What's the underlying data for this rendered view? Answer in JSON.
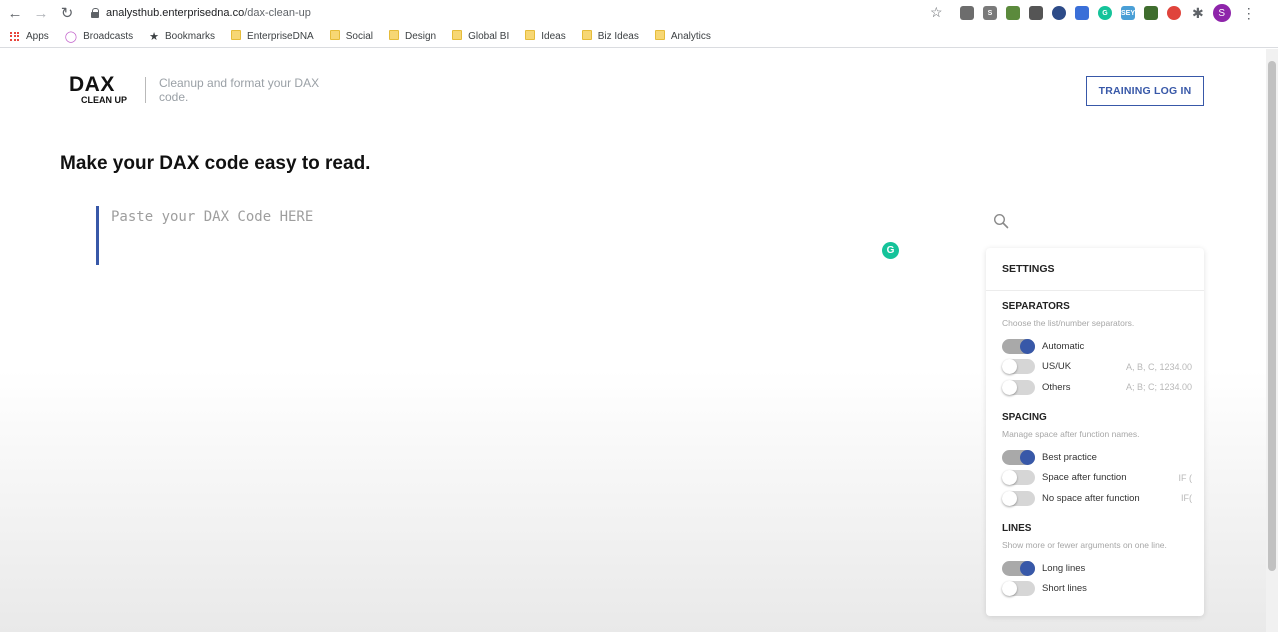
{
  "browser": {
    "url_host": "analysthub.enterprisedna.co",
    "url_path": "/dax-clean-up",
    "profile_initial": "S",
    "extensions": [
      {
        "name": "screenshot-ext-icon",
        "color": "#6d6d6d",
        "glyph": ""
      },
      {
        "name": "skype-ext-icon",
        "color": "#7a7a7a",
        "glyph": "S"
      },
      {
        "name": "evernote-ext-icon",
        "color": "#5b8a3c",
        "glyph": ""
      },
      {
        "name": "keep-ext-icon",
        "color": "#555555",
        "glyph": ""
      },
      {
        "name": "circle-ext-icon",
        "color": "#2d4b88",
        "glyph": ""
      },
      {
        "name": "reader-ext-icon",
        "color": "#3a6fd8",
        "glyph": ""
      },
      {
        "name": "grammarly-ext-icon",
        "color": "#15c39a",
        "glyph": "G"
      },
      {
        "name": "sey-ext-icon",
        "color": "#4a9fd6",
        "glyph": "SEY"
      },
      {
        "name": "leaf-ext-icon",
        "color": "#3f6d2e",
        "glyph": ""
      },
      {
        "name": "target-ext-icon",
        "color": "#e0443c",
        "glyph": ""
      }
    ],
    "bookmarks": [
      {
        "label": "Apps",
        "icon": "apps-grid-icon"
      },
      {
        "label": "Broadcasts",
        "icon": "broadcast-icon"
      },
      {
        "label": "Bookmarks",
        "icon": "star-icon"
      },
      {
        "label": "EnterpriseDNA",
        "icon": "folder-icon"
      },
      {
        "label": "Social",
        "icon": "folder-icon"
      },
      {
        "label": "Design",
        "icon": "folder-icon"
      },
      {
        "label": "Global BI",
        "icon": "folder-icon"
      },
      {
        "label": "Ideas",
        "icon": "folder-icon"
      },
      {
        "label": "Biz Ideas",
        "icon": "folder-icon"
      },
      {
        "label": "Analytics",
        "icon": "folder-icon"
      }
    ]
  },
  "header": {
    "logo_main": "DAX",
    "logo_sub": "CLEAN UP",
    "tagline": "Cleanup and format your DAX code.",
    "training_button": "TRAINING LOG IN"
  },
  "main": {
    "headline": "Make your DAX code easy to read.",
    "editor_placeholder": "Paste your DAX Code HERE"
  },
  "settings": {
    "title": "SETTINGS",
    "sections": [
      {
        "title": "SEPARATORS",
        "description": "Choose the list/number separators.",
        "options": [
          {
            "label": "Automatic",
            "hint": "",
            "on": true
          },
          {
            "label": "US/UK",
            "hint": "A, B, C, 1234.00",
            "on": false
          },
          {
            "label": "Others",
            "hint": "A; B; C; 1234.00",
            "on": false
          }
        ]
      },
      {
        "title": "SPACING",
        "description": "Manage space after function names.",
        "options": [
          {
            "label": "Best practice",
            "hint": "",
            "on": true
          },
          {
            "label": "Space after function",
            "hint": "IF (",
            "on": false
          },
          {
            "label": "No space after function",
            "hint": "IF(",
            "on": false
          }
        ]
      },
      {
        "title": "LINES",
        "description": "Show more or fewer arguments on one line.",
        "options": [
          {
            "label": "Long lines",
            "hint": "",
            "on": true
          },
          {
            "label": "Short lines",
            "hint": "",
            "on": false
          }
        ]
      }
    ]
  },
  "colors": {
    "accent": "#3858a8",
    "grammarly": "#15c39a"
  }
}
